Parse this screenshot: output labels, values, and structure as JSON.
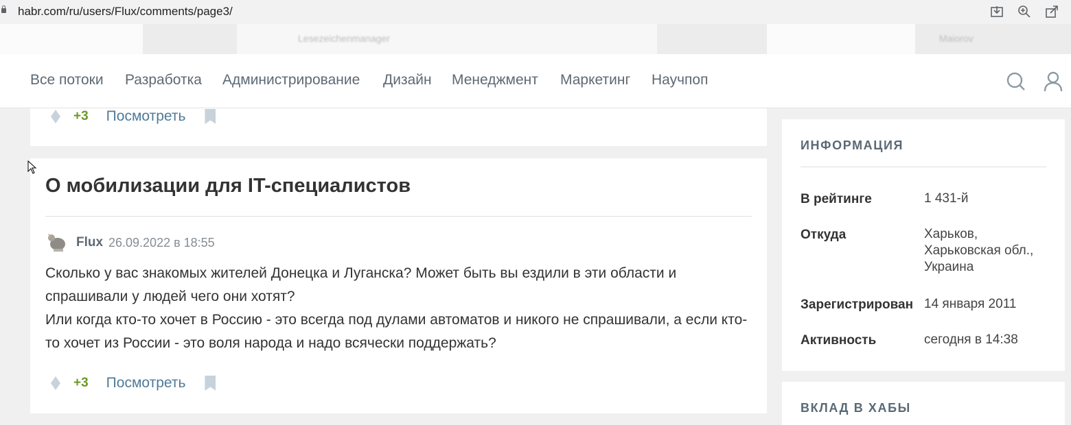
{
  "browser": {
    "url": "habr.com/ru/users/Flux/comments/page3/"
  },
  "bookmarks": {
    "items": [
      "Lesezeichenmanager",
      "Maiorov"
    ]
  },
  "nav": {
    "items": [
      "Все потоки",
      "Разработка",
      "Администрирование",
      "Дизайн",
      "Менеджмент",
      "Маркетинг",
      "Научпоп"
    ]
  },
  "card_prev": {
    "score": "+3",
    "view_label": "Посмотреть"
  },
  "comment": {
    "title": "О мобилизации для IT-специалистов",
    "author": "Flux",
    "date": "26.09.2022 в 18:55",
    "paragraphs": [
      "Сколько у вас знакомых жителей Донецка и Луганска? Может быть вы ездили в эти области и спрашивали у людей чего они хотят?",
      "Или когда кто-то хочет в Россию - это всегда под дулами автоматов и никого не спрашивали, а если кто-то хочет из России - это воля народа и надо всячески поддержать?"
    ],
    "score": "+3",
    "view_label": "Посмотреть"
  },
  "sidebar": {
    "info_title": "ИНФОРМАЦИЯ",
    "rows": [
      {
        "label": "В рейтинге",
        "value": "1 431-й"
      },
      {
        "label": "Откуда",
        "value": "Харьков, Харьковская обл., Украина"
      },
      {
        "label": "Зарегистрирован",
        "value": "14 января 2011"
      },
      {
        "label": "Активность",
        "value": "сегодня в 14:38"
      }
    ],
    "hubs_title": "ВКЛАД В ХАБЫ"
  },
  "colors": {
    "score_green": "#6b9a26",
    "link_blue": "#4f7a97",
    "nav_gray": "#5e6973"
  }
}
